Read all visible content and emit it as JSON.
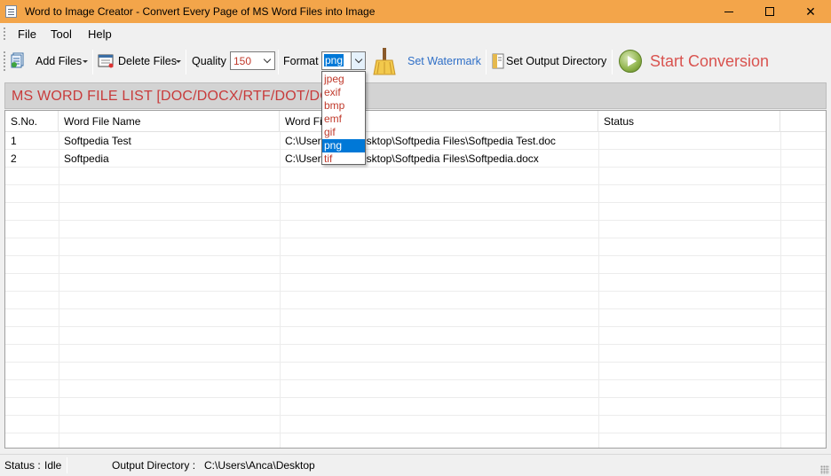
{
  "window": {
    "title": "Word to Image Creator - Convert Every Page of MS Word Files into Image",
    "title_color": "#f3a54a"
  },
  "menu": {
    "items": [
      "File",
      "Tool",
      "Help"
    ]
  },
  "toolbar": {
    "add_files": "Add Files",
    "delete_files": "Delete Files",
    "quality_label": "Quality",
    "quality_value": "150",
    "format_label": "Format",
    "format_value": "png",
    "set_watermark": "Set Watermark",
    "set_output_directory": "Set Output Directory",
    "start_conversion": "Start Conversion",
    "start_color": "#d9534f",
    "watermark_color": "#2f6fc7"
  },
  "format_dropdown": {
    "options": [
      "jpeg",
      "exif",
      "bmp",
      "emf",
      "gif",
      "png",
      "tif"
    ],
    "selected": "png"
  },
  "file_list": {
    "header": "MS WORD FILE LIST [DOC/DOCX/RTF/DOT/DOCM",
    "columns": [
      "S.No.",
      "Word File Name",
      "Word Fi",
      "Status"
    ],
    "rows": [
      {
        "sno": "1",
        "name": "Softpedia Test",
        "path_left": "C:\\Users",
        "path_right": "esktop\\Softpedia Files\\Softpedia Test.doc",
        "status": ""
      },
      {
        "sno": "2",
        "name": "Softpedia",
        "path_left": "C:\\Users",
        "path_right": "esktop\\Softpedia Files\\Softpedia.docx",
        "status": ""
      }
    ]
  },
  "status": {
    "status_label": "Status :",
    "status_value": "Idle",
    "output_label": "Output Directory :",
    "output_value": "C:\\Users\\Anca\\Desktop"
  }
}
